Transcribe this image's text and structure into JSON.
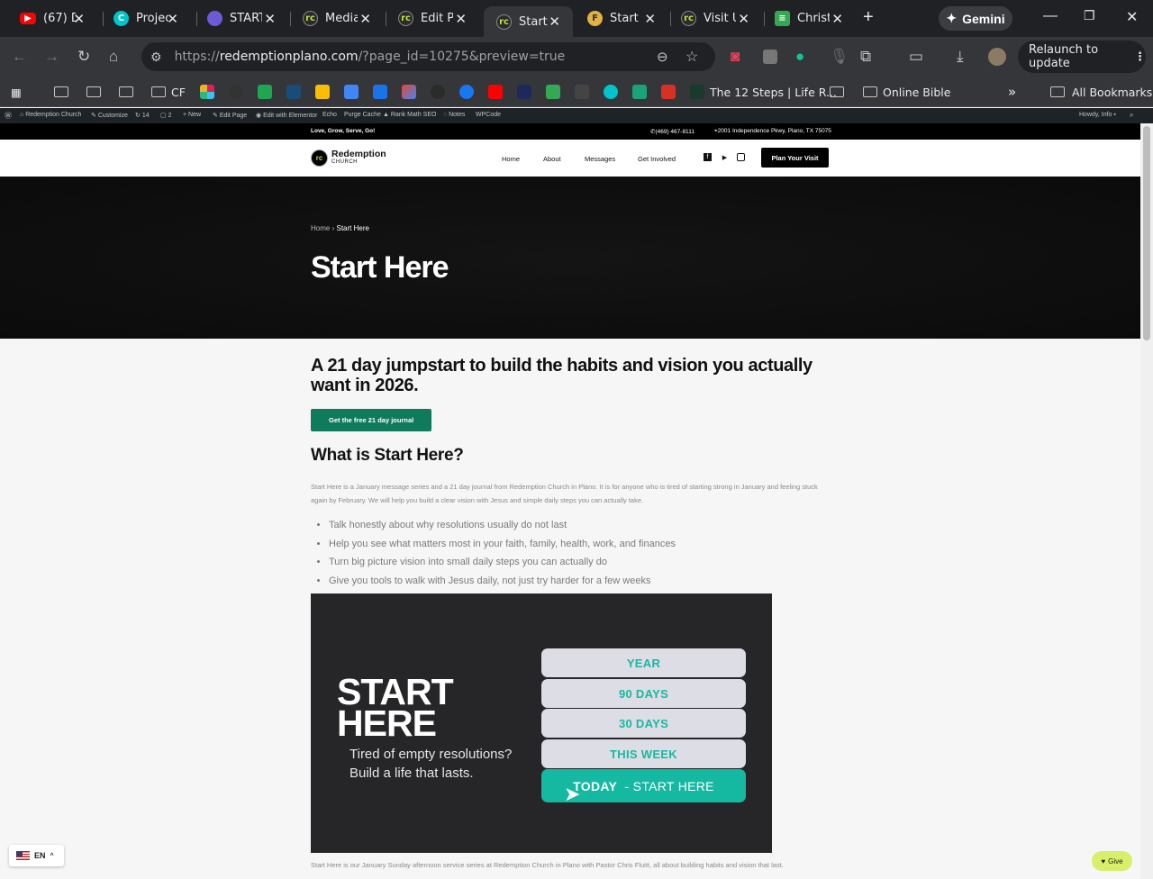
{
  "browser": {
    "tabs": [
      {
        "title": "(67) D",
        "icon": "youtube-icon",
        "color": "#ff0000"
      },
      {
        "title": "Projec",
        "icon": "canva-icon",
        "color": "#00c4cc"
      },
      {
        "title": "START",
        "icon": "app-icon",
        "color": "#6b5bd6"
      },
      {
        "title": "Media",
        "icon": "redemption-icon",
        "color": "#2b2b2b"
      },
      {
        "title": "Edit Pa",
        "icon": "redemption-icon",
        "color": "#2b2b2b"
      },
      {
        "title": "Start H",
        "icon": "redemption-icon",
        "color": "#2b2b2b"
      },
      {
        "title": "Start H",
        "icon": "f-icon",
        "color": "#e2b340"
      },
      {
        "title": "Visit U",
        "icon": "redemption-icon",
        "color": "#2b2b2b"
      },
      {
        "title": "Christ",
        "icon": "sheets-icon",
        "color": "#34a853"
      }
    ],
    "gemini_label": "Gemini",
    "url_scheme": "https://",
    "url_host": "redemptionplano.com",
    "url_path": "/?page_id=10275&preview=true",
    "relaunch_label": "Relaunch to update",
    "bookmarks": {
      "cf": "CF",
      "twelve_steps": "The 12 Steps | Life R...",
      "online_bible": "Online Bible",
      "all_bookmarks": "All Bookmarks"
    }
  },
  "wp_admin": {
    "site": "Redemption Church",
    "customize": "Customize",
    "updates": "14",
    "comments": "2",
    "new": "New",
    "edit_page": "Edit Page",
    "elementor": "Edit with Elementor",
    "echo": "Echo",
    "purge": "Purge Cache",
    "rankmath": "Rank Math SEO",
    "notes": "Notes",
    "wpcode": "WPCode",
    "howdy": "Howdy, Info"
  },
  "site": {
    "tagline": "Love, Grow, Serve, Go!",
    "phone": "(469) 467-8111",
    "address": "2001 Independence Pkwy, Plano, TX 75075",
    "logo_name": "Redemption",
    "logo_sub": "CHURCH",
    "nav": [
      "Home",
      "About",
      "Messages",
      "Get Involved"
    ],
    "plan_button": "Plan Your Visit",
    "breadcrumb_home": "Home",
    "breadcrumb_sep": "›",
    "breadcrumb_current": "Start Here",
    "hero_title": "Start Here",
    "headline": "A 21 day jumpstart to build the habits and vision you actually want in 2026.",
    "journal_button": "Get the free 21 day journal",
    "what_heading": "What is Start Here?",
    "intro": "Start Here is a January message series and a 21 day journal from Redemption Church in Plano. It is for anyone who is tired of starting strong in January and feeling stuck again by February. We will help you build a clear vision with Jesus and simple daily steps you can actually take.",
    "bullets": [
      "Talk honestly about why resolutions usually do not last",
      "Help you see what matters most in your faith, family, health, work, and finances",
      "Turn big picture vision into small daily steps you can actually do",
      "Give you tools to walk with Jesus daily, not just try harder for a few weeks"
    ],
    "banner": {
      "title_line1": "START",
      "title_line2": "HERE",
      "sub_line1": "Tired of empty resolutions?",
      "sub_line2": "Build a life that lasts.",
      "pills": [
        "YEAR",
        "90 DAYS",
        "30 DAYS",
        "THIS WEEK"
      ],
      "today": "TODAY",
      "today_rest": "- START HERE"
    },
    "footer_para": "Start Here is our January Sunday afternoon service series at Redemption Church in Plano with Pastor Chris Fluitt, all about building habits and vision that last."
  },
  "widgets": {
    "lang": "EN",
    "give": "Give"
  },
  "colors": {
    "accent_green": "#0f7a5c",
    "teal": "#15b8a0",
    "brand_lime": "#b7e43c"
  }
}
